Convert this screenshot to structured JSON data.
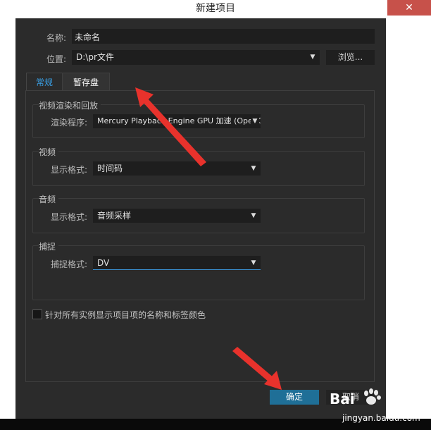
{
  "window": {
    "title": "新建项目",
    "close_glyph": "✕"
  },
  "form": {
    "name_label": "名称:",
    "name_value": "未命名",
    "location_label": "位置:",
    "location_value": "D:\\pr文件",
    "browse_label": "浏览..."
  },
  "tabs": [
    {
      "label": "常规",
      "active": true
    },
    {
      "label": "暂存盘",
      "active": false
    }
  ],
  "groups": {
    "render": {
      "title": "视频渲染和回放",
      "field_label": "渲染程序:",
      "field_value": "Mercury Playback Engine GPU 加速 (OpenCL)"
    },
    "video": {
      "title": "视频",
      "field_label": "显示格式:",
      "field_value": "时间码"
    },
    "audio": {
      "title": "音频",
      "field_label": "显示格式:",
      "field_value": "音频采样"
    },
    "capture": {
      "title": "捕捉",
      "field_label": "捕捉格式:",
      "field_value": "DV"
    }
  },
  "checkbox": {
    "label": "针对所有实例显示项目项的名称和标签颜色",
    "checked": false
  },
  "buttons": {
    "ok": "确定",
    "cancel": "取消"
  },
  "watermark": {
    "brand": "Bai",
    "brand_suffix": "经验",
    "url": "jingyan.baidu.com"
  },
  "colors": {
    "dialog_bg": "#2b2b2b",
    "accent_blue": "#1f6f97",
    "active_tab_text": "#3aa0e6",
    "annotation_red": "#e8322c",
    "close_button": "#c7514a"
  },
  "icons": {
    "dropdown": "chevron-down-icon",
    "close": "close-icon",
    "annotation": "red-arrow-icon"
  }
}
